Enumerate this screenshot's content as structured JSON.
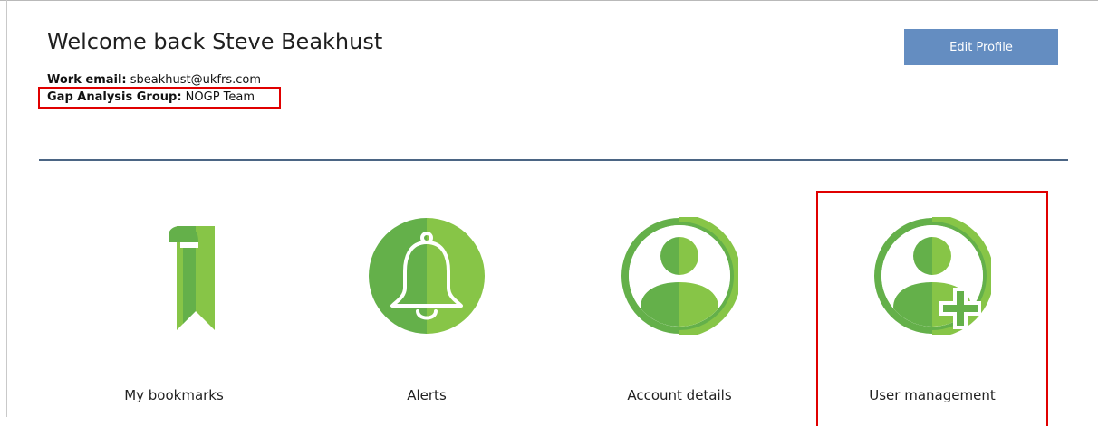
{
  "header": {
    "welcome": "Welcome back Steve Beakhust",
    "email_label": "Work email:",
    "email_value": "sbeakhust@ukfrs.com",
    "group_label": "Gap Analysis Group:",
    "group_value": "NOGP Team",
    "edit_profile_label": "Edit Profile"
  },
  "tiles": [
    {
      "label": "My bookmarks",
      "icon": "bookmark-icon"
    },
    {
      "label": "Alerts",
      "icon": "bell-icon"
    },
    {
      "label": "Account details",
      "icon": "user-icon"
    },
    {
      "label": "User management",
      "icon": "add-user-icon"
    }
  ],
  "colors": {
    "icon_dark_green": "#64b04a",
    "icon_light_green": "#87c547",
    "button_blue": "#648dc1",
    "divider": "#4b6584",
    "highlight_red": "#e00000"
  }
}
